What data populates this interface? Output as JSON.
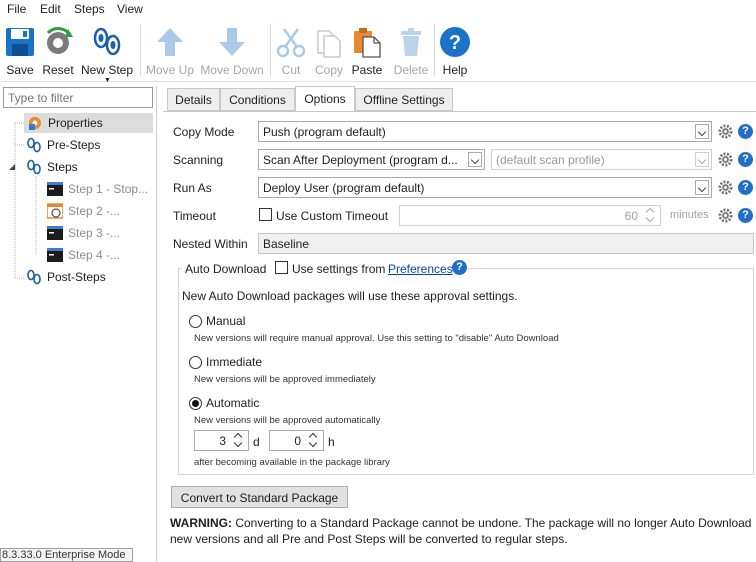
{
  "menu": [
    "File",
    "Edit",
    "Steps",
    "View"
  ],
  "toolbar": {
    "save": "Save",
    "reset": "Reset",
    "new_step": "New Step",
    "move_up": "Move Up",
    "move_down": "Move Down",
    "cut": "Cut",
    "copy": "Copy",
    "paste": "Paste",
    "delete": "Delete",
    "help": "Help"
  },
  "filter": {
    "placeholder": "Type to filter"
  },
  "tree": {
    "properties": "Properties",
    "pre_steps": "Pre-Steps",
    "steps": "Steps",
    "step1": "Step 1 - Stop...",
    "step2": "Step 2 -...",
    "step3": "Step 3 -...",
    "step4": "Step 4 -...",
    "post_steps": "Post-Steps"
  },
  "version": "8.3.33.0 Enterprise Mode",
  "tabs": [
    "Details",
    "Conditions",
    "Options",
    "Offline Settings"
  ],
  "active_tab": "Options",
  "form": {
    "copy_mode_label": "Copy Mode",
    "copy_mode_value": "Push (program default)",
    "scanning_label": "Scanning",
    "scanning_value": "Scan After Deployment (program d...",
    "scan_profile_value": "(default scan profile)",
    "run_as_label": "Run As",
    "run_as_value": "Deploy User (program default)",
    "timeout_label": "Timeout",
    "custom_timeout_label": "Use Custom Timeout",
    "timeout_value": "60",
    "timeout_unit": "minutes",
    "nested_within_label": "Nested Within",
    "nested_within_value": "Baseline"
  },
  "auto_download": {
    "title": "Auto Download",
    "use_settings_label": "Use settings from",
    "preferences_link": "Preferences",
    "intro": "New Auto Download packages will use these approval settings.",
    "manual_label": "Manual",
    "manual_desc": "New versions will require manual approval. Use this setting to \"disable\" Auto Download",
    "immediate_label": "Immediate",
    "immediate_desc": "New versions will be approved immediately",
    "automatic_label": "Automatic",
    "automatic_desc": "New versions will be approved automatically",
    "days_value": "3",
    "days_unit": "d",
    "hours_value": "0",
    "hours_unit": "h",
    "after_text": "after becoming available in the package library",
    "selected": "automatic"
  },
  "convert_button": "Convert to Standard Package",
  "warning": {
    "prefix": "WARNING:",
    "text": "Converting to a Standard Package cannot be undone. The package will no longer Auto Download new versions and all Pre and Post Steps will be converted to regular steps."
  },
  "colors": {
    "accent_blue": "#1f6fc5",
    "link": "#0645ad",
    "disabled_text": "#a6a6a6"
  }
}
